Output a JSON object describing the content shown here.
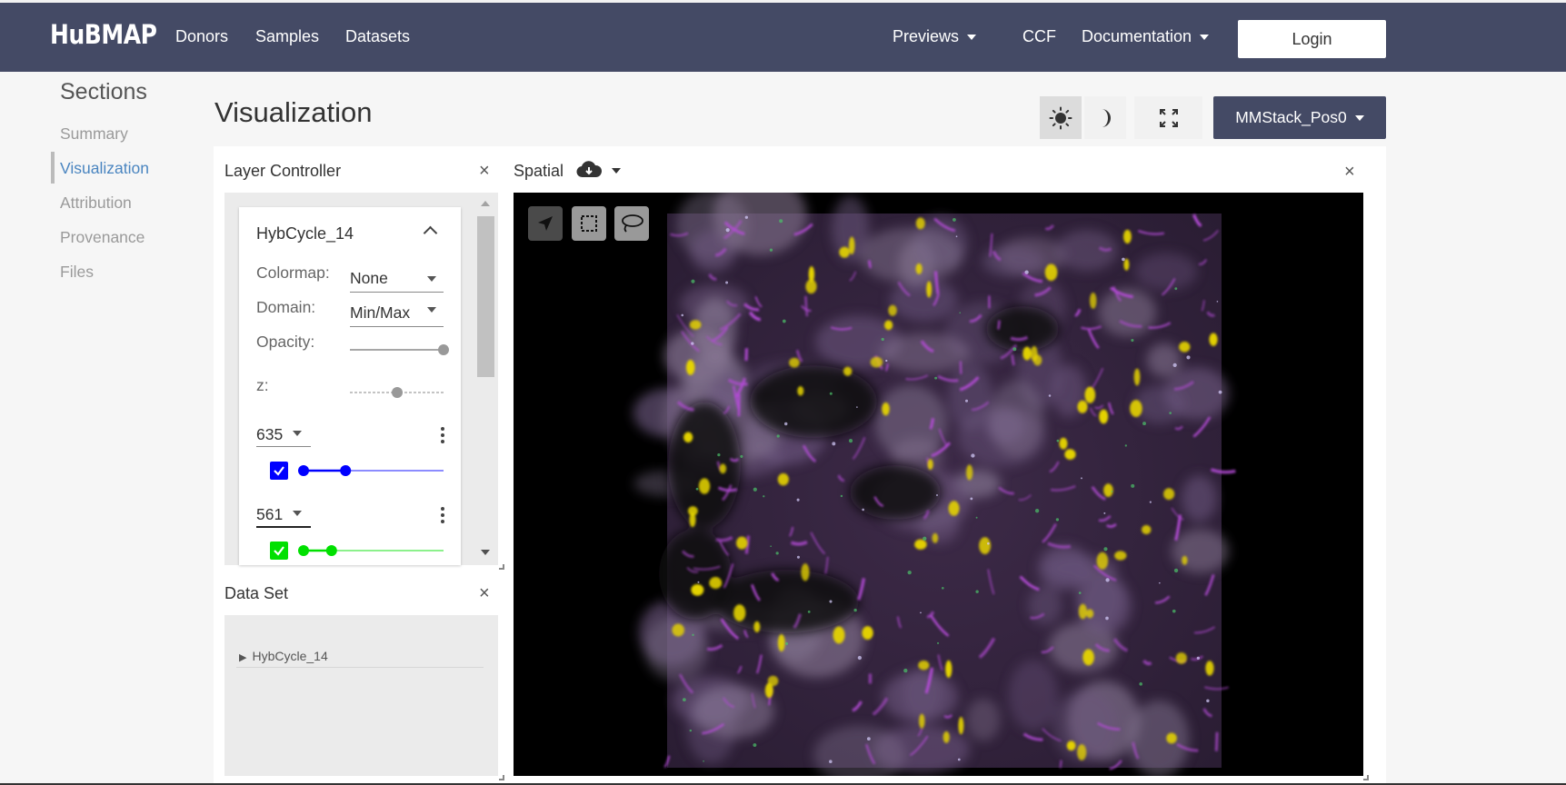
{
  "navbar": {
    "logo": "HuBMAP",
    "links": [
      "Donors",
      "Samples",
      "Datasets"
    ],
    "previews_label": "Previews",
    "ccf_label": "CCF",
    "documentation_label": "Documentation",
    "login_label": "Login"
  },
  "sidebar": {
    "title": "Sections",
    "items": [
      "Summary",
      "Visualization",
      "Attribution",
      "Provenance",
      "Files"
    ],
    "active": "Visualization"
  },
  "visualization": {
    "title": "Visualization",
    "dataset_select": "MMStack_Pos0"
  },
  "layer_controller": {
    "title": "Layer Controller",
    "layer_name": "HybCycle_14",
    "colormap_label": "Colormap:",
    "colormap_value": "None",
    "domain_label": "Domain:",
    "domain_value": "Min/Max",
    "opacity_label": "Opacity:",
    "opacity_value": 1.0,
    "z_label": "z:",
    "z_value": 0.5,
    "channels": [
      {
        "name": "635",
        "color": "#0000ff",
        "checked": true,
        "range": [
          0.0,
          0.3
        ]
      },
      {
        "name": "561",
        "color": "#00e000",
        "checked": true,
        "range": [
          0.0,
          0.2
        ]
      }
    ]
  },
  "data_set": {
    "title": "Data Set",
    "item": "HybCycle_14"
  },
  "spatial": {
    "title": "Spatial",
    "tools": [
      "pointer-tool",
      "rectangle-select-tool",
      "lasso-tool"
    ]
  },
  "colors": {
    "navbar_bg": "#444a65",
    "active_section": "#4a85c0",
    "image_magenta": "#b44bd6",
    "image_yellow": "#e6d400"
  }
}
